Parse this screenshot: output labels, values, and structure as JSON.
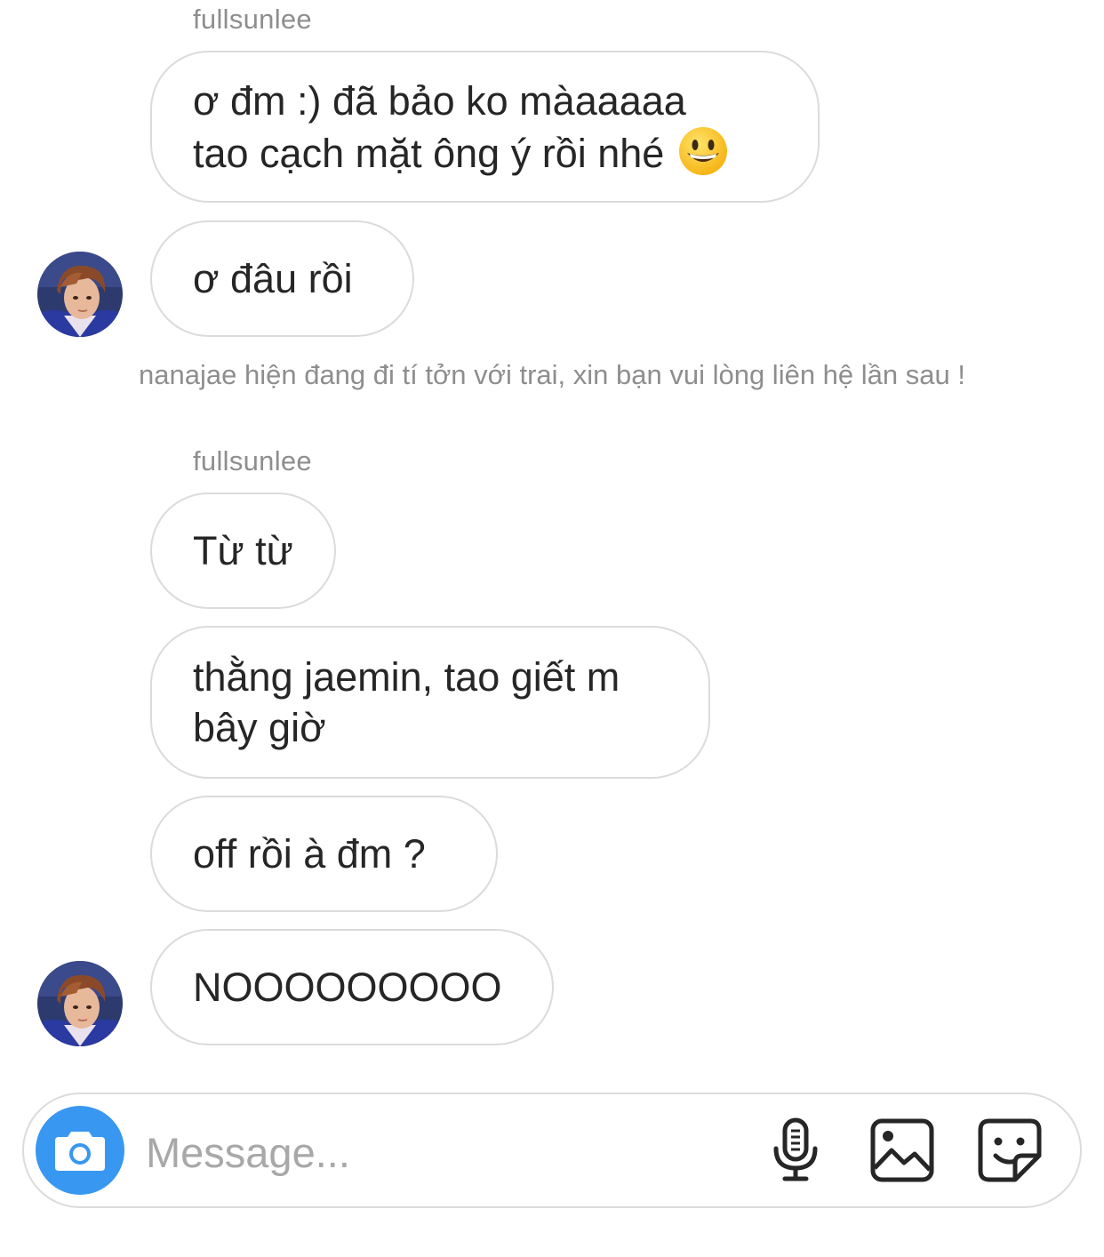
{
  "thread": {
    "messages_top": [
      {
        "sender": "fullsunlee"
      },
      {
        "bubble1": "ơ đm :) đã bảo ko màaaaaa\ntao cạch mặt ông ý rồi nhé"
      },
      {
        "bubble2": "ơ đâu rồi"
      }
    ],
    "group1": {
      "sender": "fullsunlee",
      "msg1": "ơ đm :) đã bảo ko màaaaaa\ntao cạch mặt ông ý rồi nhé",
      "msg1_emoji": "grinning-face-emoji",
      "msg2": "ơ đâu rồi"
    },
    "status_notice": "nanajae hiện đang đi tí tởn với trai, xin bạn vui lòng liên hệ lần sau !",
    "group2": {
      "sender": "fullsunlee",
      "msg1": "Từ từ",
      "msg2": "thằng jaemin, tao giết m\nbây giờ",
      "msg3": "off rồi à đm ?",
      "msg4": "NOOOOOOOOO"
    }
  },
  "composer": {
    "placeholder": "Message...",
    "value": "",
    "icons": [
      "camera-icon",
      "microphone-icon",
      "gallery-icon",
      "sticker-icon"
    ],
    "camera_color": "#3897f0"
  }
}
